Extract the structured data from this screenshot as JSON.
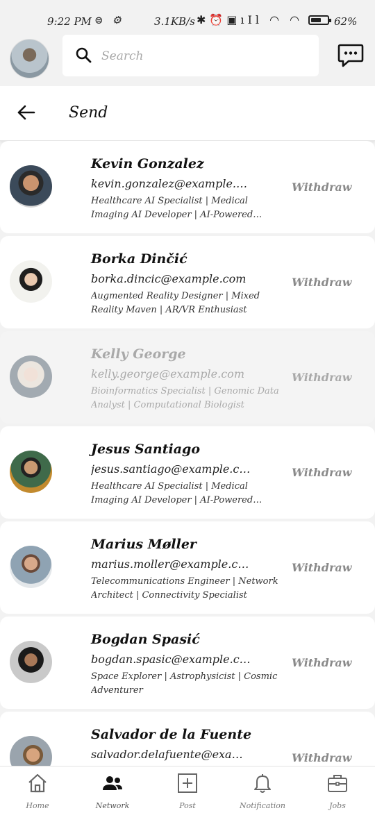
{
  "status_bar": {
    "time": "9:22 PM",
    "speed": "3.1KB/s",
    "battery_percent": "62%",
    "battery_level": 0.62
  },
  "search": {
    "placeholder": "Search"
  },
  "header": {
    "title": "Send"
  },
  "invitations": [
    {
      "name": "Kevin Gonzalez",
      "email": "kevin.gonzalez@example.com",
      "headline": "Healthcare AI Specialist | Medical Imaging AI Developer | AI-Powered Diagnostics Expert",
      "action": "Withdraw",
      "dimmed": false
    },
    {
      "name": "Borka Dinčić",
      "email": "borka.dincic@example.com",
      "headline": "Augmented Reality Designer | Mixed Reality Maven | AR/VR Enthusiast",
      "action": "Withdraw",
      "dimmed": false
    },
    {
      "name": "Kelly George",
      "email": "kelly.george@example.com",
      "headline": "Bioinformatics Specialist | Genomic Data Analyst | Computational Biologist",
      "action": "Withdraw",
      "dimmed": true
    },
    {
      "name": "Jesus Santiago",
      "email": "jesus.santiago@example.com",
      "headline": "Healthcare AI Specialist | Medical Imaging AI Developer | AI-Powered Diagnostics Expert",
      "action": "Withdraw",
      "dimmed": false
    },
    {
      "name": "Marius Møller",
      "email": "marius.moller@example.com",
      "headline": "Telecommunications Engineer | Network Architect | Connectivity Specialist",
      "action": "Withdraw",
      "dimmed": false
    },
    {
      "name": "Bogdan Spasić",
      "email": "bogdan.spasic@example.com",
      "headline": "Space Explorer | Astrophysicist | Cosmic Adventurer",
      "action": "Withdraw",
      "dimmed": false
    },
    {
      "name": "Salvador de la Fuente",
      "email": "salvador.delafuente@example.com",
      "headline": "",
      "action": "Withdraw",
      "dimmed": false
    }
  ],
  "nav": [
    {
      "label": "Home",
      "icon": "home-icon"
    },
    {
      "label": "Network",
      "icon": "network-icon",
      "active": true
    },
    {
      "label": "Post",
      "icon": "post-icon"
    },
    {
      "label": "Notification",
      "icon": "bell-icon"
    },
    {
      "label": "Jobs",
      "icon": "briefcase-icon"
    }
  ]
}
